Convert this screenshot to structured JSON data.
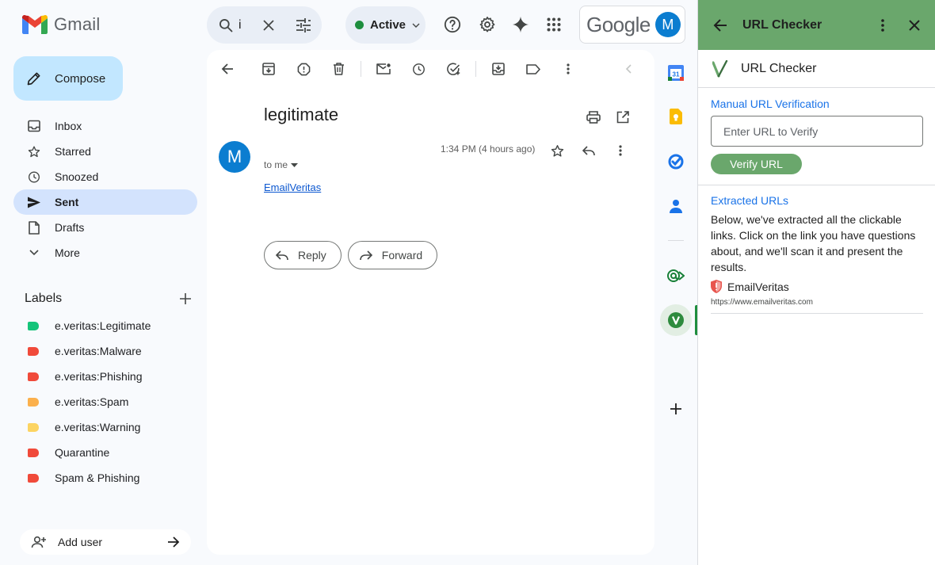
{
  "header": {
    "app_name": "Gmail",
    "search_value": "i",
    "status": "Active",
    "google_word": "Google",
    "account_initial": "M"
  },
  "sidebar": {
    "compose": "Compose",
    "items": [
      {
        "label": "Inbox",
        "icon": "inbox-icon"
      },
      {
        "label": "Starred",
        "icon": "star-icon"
      },
      {
        "label": "Snoozed",
        "icon": "clock-icon"
      },
      {
        "label": "Sent",
        "icon": "send-icon",
        "active": true
      },
      {
        "label": "Drafts",
        "icon": "draft-icon"
      },
      {
        "label": "More",
        "icon": "chevron-down-icon"
      }
    ],
    "labels_title": "Labels",
    "labels": [
      {
        "name": "e.veritas:Legitimate",
        "color": "#16c47a"
      },
      {
        "name": "e.veritas:Malware",
        "color": "#f04a3a"
      },
      {
        "name": "e.veritas:Phishing",
        "color": "#f04a3a"
      },
      {
        "name": "e.veritas:Spam",
        "color": "#fbb04c"
      },
      {
        "name": "e.veritas:Warning",
        "color": "#fcd462"
      },
      {
        "name": "Quarantine",
        "color": "#f04a3a"
      },
      {
        "name": "Spam & Phishing",
        "color": "#f04a3a"
      }
    ],
    "add_user": "Add user"
  },
  "email": {
    "subject": "legitimate",
    "sender_initial": "M",
    "to": "to me",
    "time": "1:34 PM (4 hours ago)",
    "link_text": "EmailVeritas",
    "reply_label": "Reply",
    "forward_label": "Forward"
  },
  "panel": {
    "title": "URL Checker",
    "brand_name": "URL Checker",
    "manual_title": "Manual URL Verification",
    "input_placeholder": "Enter URL to Verify",
    "verify_label": "Verify URL",
    "extracted_title": "Extracted URLs",
    "description": "Below, we've extracted all the clickable links. Click on the link you have questions about, and we'll scan it and present the results.",
    "links": [
      {
        "name": "EmailVeritas",
        "url": "https://www.emailveritas.com"
      }
    ]
  },
  "colors": {
    "accent_green": "#6aa76c",
    "compose_bg": "#c2e7ff",
    "active_nav_bg": "#d3e3fd",
    "link_blue": "#0b57d0"
  }
}
